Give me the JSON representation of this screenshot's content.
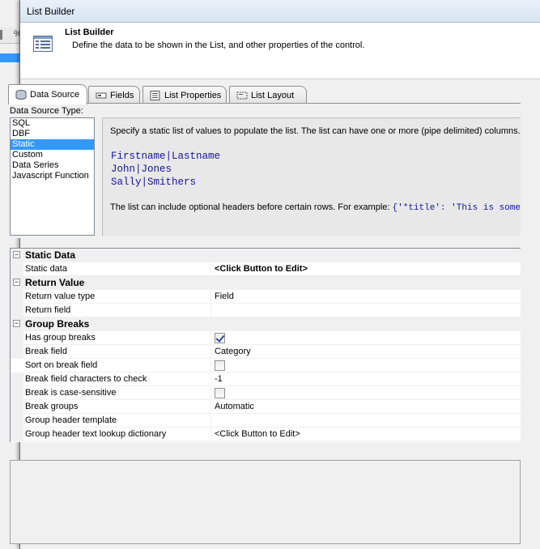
{
  "window": {
    "title": "List Builder"
  },
  "header": {
    "title": "List Builder",
    "description": "Define the data to be shown in the List, and other properties of the control."
  },
  "tabs": [
    {
      "label": "Data Source",
      "icon": "database-icon",
      "active": true
    },
    {
      "label": "Fields",
      "icon": "fields-icon",
      "active": false
    },
    {
      "label": "List Properties",
      "icon": "properties-icon",
      "active": false
    },
    {
      "label": "List Layout",
      "icon": "layout-icon",
      "active": false
    }
  ],
  "data_source": {
    "label": "Data Source Type:",
    "items": [
      "SQL",
      "DBF",
      "Static",
      "Custom",
      "Data Series",
      "Javascript Function"
    ],
    "selected": "Static"
  },
  "info": {
    "intro": "Specify a static list of values to populate the list. The list can have one or more (pipe delimited) columns. F",
    "code_lines": [
      "Firstname|Lastname",
      "John|Jones",
      "Sally|Smithers"
    ],
    "headers_text": "The list can include optional headers before certain rows. For example: ",
    "headers_code": "{'*title': 'This is some"
  },
  "property_grid": {
    "static_data": {
      "category": "Static Data",
      "static_data_label": "Static data",
      "static_data_value": "<Click Button to Edit>"
    },
    "return_value": {
      "category": "Return Value",
      "return_value_type_label": "Return value type",
      "return_value_type_value": "Field",
      "return_field_label": "Return field",
      "return_field_value": ""
    },
    "group_breaks": {
      "category": "Group Breaks",
      "has_group_breaks_label": "Has group breaks",
      "has_group_breaks_checked": true,
      "break_field_label": "Break field",
      "break_field_value": "Category",
      "sort_on_break_field_label": "Sort on break field",
      "sort_on_break_field_checked": false,
      "break_chars_label": "Break field characters to check",
      "break_chars_value": "-1",
      "case_sensitive_label": "Break is case-sensitive",
      "case_sensitive_checked": false,
      "break_groups_label": "Break groups",
      "break_groups_value": "Automatic",
      "header_template_label": "Group header template",
      "header_template_value": "",
      "header_lookup_label": "Group header text lookup dictionary",
      "header_lookup_value": "<Click Button to Edit>"
    }
  },
  "background_app": {
    "toolbar_glyph": "%"
  },
  "colors": {
    "selection": "#3399ff",
    "highlight": "#ffff00",
    "code_text": "#1414a0"
  }
}
